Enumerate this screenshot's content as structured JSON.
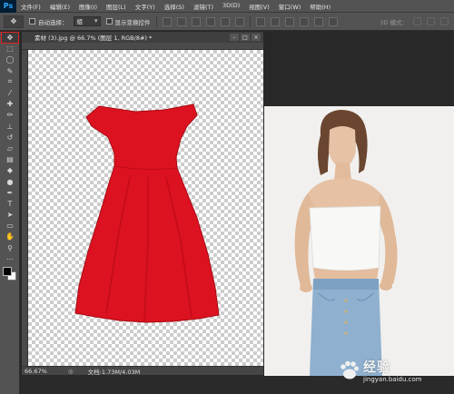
{
  "app": {
    "logo": "Ps"
  },
  "menu": [
    "文件(F)",
    "编辑(E)",
    "图像(I)",
    "图层(L)",
    "文字(Y)",
    "选择(S)",
    "滤镜(T)",
    "3D(D)",
    "视图(V)",
    "窗口(W)",
    "帮助(H)"
  ],
  "options": {
    "auto_select_label": "自动选择：",
    "auto_select_value": "组",
    "show_transform_label": "显示变换控件",
    "mode_3d_label": "3D 模式："
  },
  "document": {
    "tab_title": "素材 (3).jpg @ 66.7% (图层 1, RGB/8#) *",
    "zoom": "66.67%",
    "doc_info": "文档:1.73M/4.03M"
  },
  "colors": {
    "dress": "#dc1220",
    "dress_shadow": "#a80812",
    "active_tool_outline": "#e02020",
    "ps_blue": "#31a8ff"
  },
  "tools": [
    "move-icon",
    "marquee-icon",
    "lasso-icon",
    "quick-select-icon",
    "crop-icon",
    "eyedropper-icon",
    "healing-icon",
    "brush-icon",
    "stamp-icon",
    "history-brush-icon",
    "eraser-icon",
    "gradient-icon",
    "blur-icon",
    "dodge-icon",
    "pen-icon",
    "type-icon",
    "path-select-icon",
    "shape-icon",
    "hand-icon",
    "zoom-icon",
    "more-icon"
  ],
  "watermark": {
    "brand": "经验",
    "url": "jingyan.baidu.com"
  }
}
